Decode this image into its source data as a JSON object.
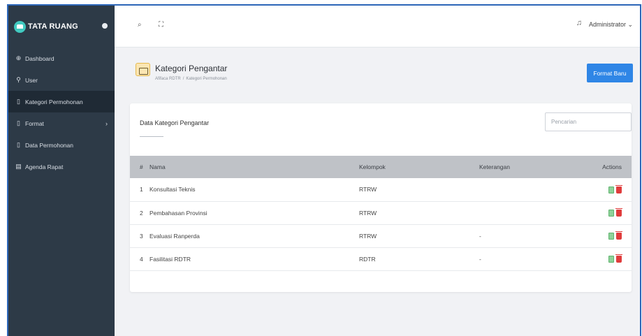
{
  "brand": {
    "name": "TATA RUANG"
  },
  "sidebar": {
    "items": [
      {
        "label": "Dashboard",
        "icon": "dashboard-icon",
        "glyph": "⊕"
      },
      {
        "label": "User",
        "icon": "user-icon",
        "glyph": "⚲"
      },
      {
        "label": "Kategori Permohonan",
        "icon": "document-icon",
        "glyph": "▯"
      },
      {
        "label": "Format",
        "icon": "document-icon",
        "glyph": "▯"
      },
      {
        "label": "Data Permohonan",
        "icon": "document-icon",
        "glyph": "▯"
      },
      {
        "label": "Agenda Rapat",
        "icon": "calendar-icon",
        "glyph": "▤"
      }
    ]
  },
  "topbar": {
    "user": "Administrator ⌄"
  },
  "page": {
    "title": "Kategori Pengantar",
    "breadcrumb": [
      "Afifaca RDTR",
      "Kategori Permohonan"
    ],
    "add_button": "Format Baru"
  },
  "card": {
    "title": "Data Kategori Pengantar",
    "search_placeholder": "Pencarian"
  },
  "table": {
    "headers": {
      "no": "#",
      "nama": "Nama",
      "kelompok": "Kelompok",
      "keterangan": "Keterangan",
      "actions": "Actions"
    },
    "rows": [
      {
        "no": "1",
        "nama": "Konsultasi Teknis",
        "kelompok": "RTRW",
        "keterangan": ""
      },
      {
        "no": "2",
        "nama": "Pembahasan Provinsi",
        "kelompok": "RTRW",
        "keterangan": ""
      },
      {
        "no": "3",
        "nama": "Evaluasi Ranperda",
        "kelompok": "RTRW",
        "keterangan": "-"
      },
      {
        "no": "4",
        "nama": "Fasilitasi RDTR",
        "kelompok": "RDTR",
        "keterangan": "-"
      }
    ]
  },
  "colors": {
    "sidebar": "#2d3a47",
    "accent": "#2f86e6",
    "table_header": "#bfc2c7",
    "delete": "#e03c3c",
    "edit": "#8fd29a"
  }
}
